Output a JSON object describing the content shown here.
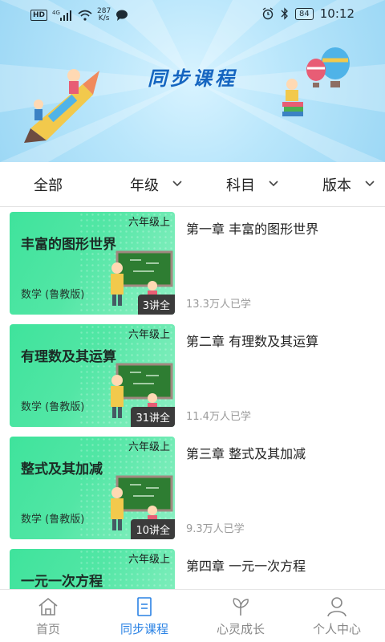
{
  "status_bar": {
    "network_badge": "HD",
    "signal": "4G",
    "speed_value": "287",
    "speed_unit": "K/s",
    "battery": "84",
    "time": "10:12"
  },
  "banner": {
    "title": "同步课程"
  },
  "filters": [
    {
      "label": "全部",
      "has_dropdown": false
    },
    {
      "label": "年级",
      "has_dropdown": true
    },
    {
      "label": "科目",
      "has_dropdown": true
    },
    {
      "label": "版本",
      "has_dropdown": true
    }
  ],
  "courses": [
    {
      "grade": "六年级上",
      "thumb_title": "丰富的图形世界",
      "subject": "数学 (鲁教版)",
      "lessons": "3讲全",
      "chapter": "第一章 丰富的图形世界",
      "learners": "13.3万人已学"
    },
    {
      "grade": "六年级上",
      "thumb_title": "有理数及其运算",
      "subject": "数学 (鲁教版)",
      "lessons": "31讲全",
      "chapter": "第二章 有理数及其运算",
      "learners": "11.4万人已学"
    },
    {
      "grade": "六年级上",
      "thumb_title": "整式及其加减",
      "subject": "数学 (鲁教版)",
      "lessons": "10讲全",
      "chapter": "第三章 整式及其加减",
      "learners": "9.3万人已学"
    },
    {
      "grade": "六年级上",
      "thumb_title": "一元一次方程",
      "subject": "",
      "lessons": "",
      "chapter": "第四章 一元一次方程",
      "learners": ""
    }
  ],
  "tabs": [
    {
      "label": "首页",
      "icon": "home-icon",
      "active": false
    },
    {
      "label": "同步课程",
      "icon": "book-icon",
      "active": true
    },
    {
      "label": "心灵成长",
      "icon": "leaf-icon",
      "active": false
    },
    {
      "label": "个人中心",
      "icon": "person-icon",
      "active": false
    }
  ],
  "colors": {
    "accent": "#2a82e4",
    "thumb_green": "#3fe39c",
    "banner_blue": "#b9e6fb",
    "title_blue": "#1565c0"
  }
}
